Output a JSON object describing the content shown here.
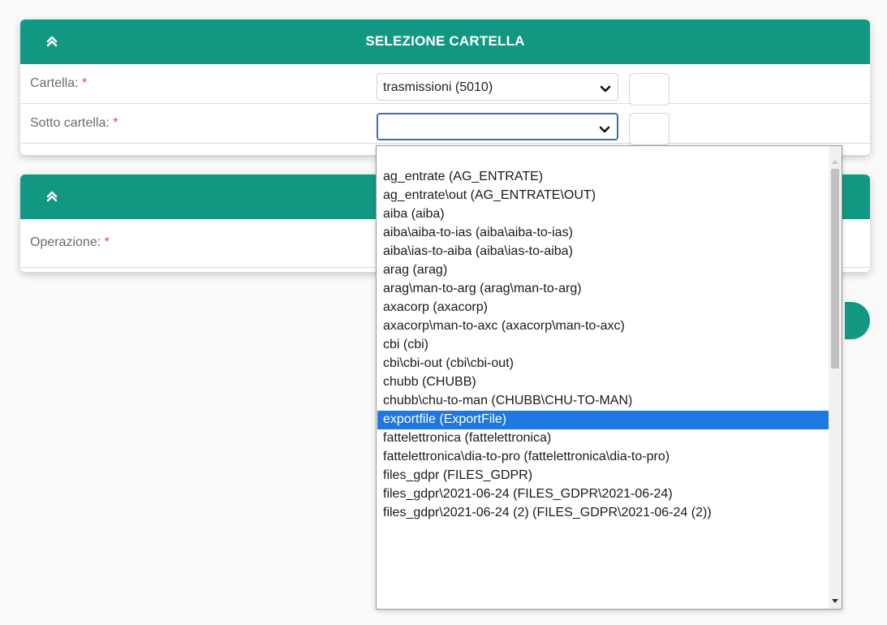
{
  "panel1": {
    "title": "SELEZIONE CARTELLA",
    "rows": [
      {
        "label": "Cartella:",
        "required": "*",
        "value": "trasmissioni (5010)"
      },
      {
        "label": "Sotto cartella:",
        "required": "*",
        "value": ""
      }
    ]
  },
  "panel2": {
    "title": "",
    "rows": [
      {
        "label": "Operazione:",
        "required": "*"
      }
    ]
  },
  "dropdown": {
    "options": [
      "ag_entrate (AG_ENTRATE)",
      "ag_entrate\\out (AG_ENTRATE\\OUT)",
      "aiba (aiba)",
      "aiba\\aiba-to-ias (aiba\\aiba-to-ias)",
      "aiba\\ias-to-aiba (aiba\\ias-to-aiba)",
      "arag (arag)",
      "arag\\man-to-arg (arag\\man-to-arg)",
      "axacorp (axacorp)",
      "axacorp\\man-to-axc (axacorp\\man-to-axc)",
      "cbi (cbi)",
      "cbi\\cbi-out (cbi\\cbi-out)",
      "chubb (CHUBB)",
      "chubb\\chu-to-man (CHUBB\\CHU-TO-MAN)",
      "exportfile (ExportFile)",
      "fattelettronica (fattelettronica)",
      "fattelettronica\\dia-to-pro (fattelettronica\\dia-to-pro)",
      "files_gdpr (FILES_GDPR)",
      "files_gdpr\\2021-06-24 (FILES_GDPR\\2021-06-24)",
      "files_gdpr\\2021-06-24 (2) (FILES_GDPR\\2021-06-24 (2))"
    ],
    "highlighted": "exportfile (ExportFile)"
  },
  "colors": {
    "header": "#129882",
    "highlight": "#1e78e0",
    "required": "#e0453b",
    "focus": "#3b6fb6"
  },
  "icons": [
    "chevrons-up-icon",
    "chevron-down-icon",
    "scroll-up-arrow-icon",
    "scroll-down-arrow-icon"
  ]
}
